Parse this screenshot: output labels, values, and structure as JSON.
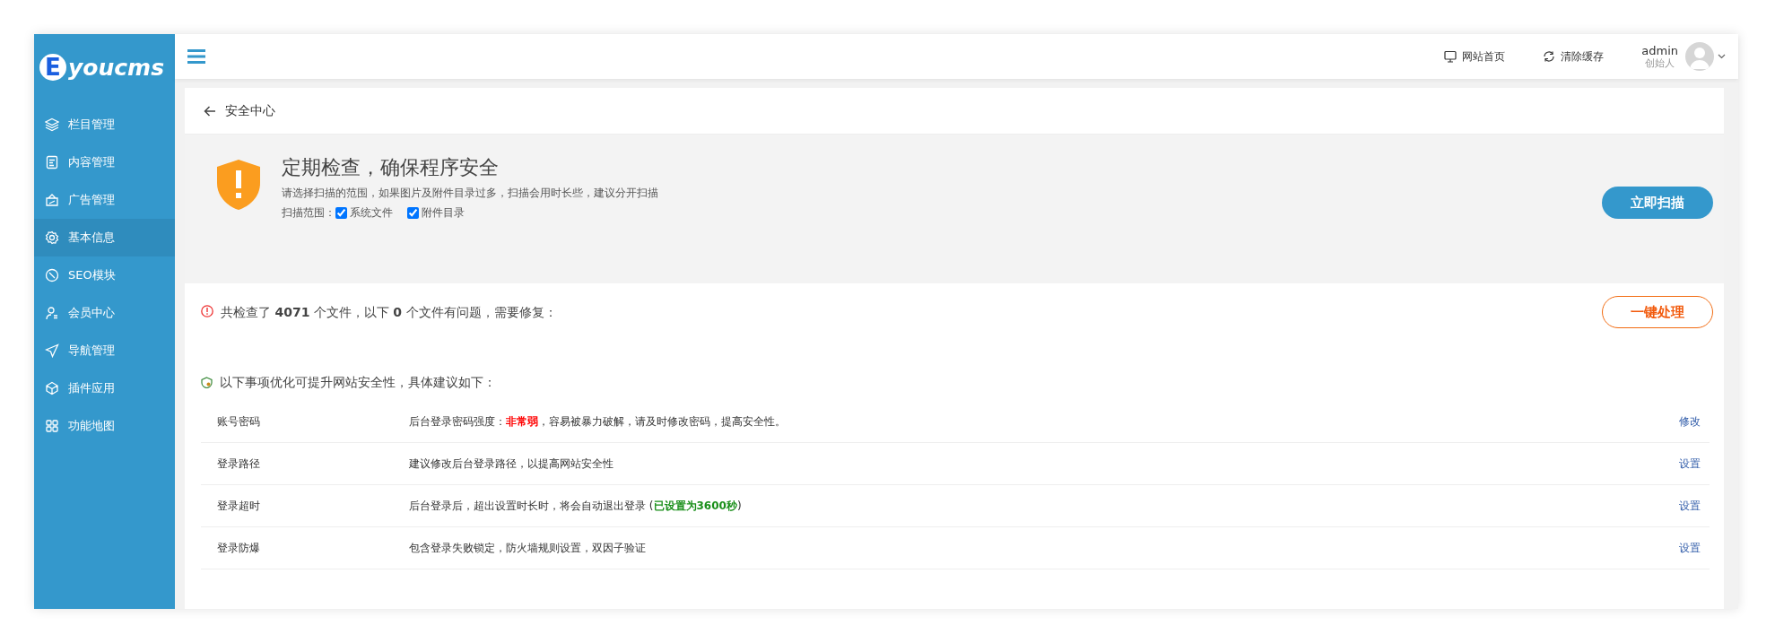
{
  "logo": {
    "mark": "E",
    "text": "youcms"
  },
  "sidebar": {
    "items": [
      {
        "label": "栏目管理",
        "selected": false
      },
      {
        "label": "内容管理",
        "selected": false
      },
      {
        "label": "广告管理",
        "selected": false
      },
      {
        "label": "基本信息",
        "selected": true
      },
      {
        "label": "SEO模块",
        "selected": false
      },
      {
        "label": "会员中心",
        "selected": false
      },
      {
        "label": "导航管理",
        "selected": false
      },
      {
        "label": "插件应用",
        "selected": false
      },
      {
        "label": "功能地图",
        "selected": false
      }
    ]
  },
  "header": {
    "links": [
      "网站首页",
      "清除缓存"
    ],
    "user": {
      "name": "admin",
      "role": "创始人"
    }
  },
  "page_title": "安全中心",
  "scan_panel": {
    "title": "定期检查，确保程序安全",
    "hint": "请选择扫描的范围，如果图片及附件目录过多，扫描会用时长些，建议分开扫描",
    "scope_label": "扫描范围：",
    "options": [
      {
        "label": "系统文件",
        "checked": true
      },
      {
        "label": "附件目录",
        "checked": true
      }
    ],
    "button": "立即扫描"
  },
  "result": {
    "summary": "共检查了 **4071** 个文件，以下 **0** 个文件有问题，需要修复：",
    "button": "一键处理"
  },
  "suggestions": {
    "heading": "以下事项优化可提升网站安全性，具体建议如下：",
    "rows": [
      {
        "name": "账号密码",
        "description": [
          "后台登录密码强度：",
          {
            "text": "非常弱",
            "color": "#ff0000"
          },
          "，容易被暴力破解，请及时修改密码，提高安全性。"
        ],
        "action": "修改"
      },
      {
        "name": "登录路径",
        "description": [
          "建议修改后台登录路径，以提高网站安全性"
        ],
        "action": "设置"
      },
      {
        "name": "登录超时",
        "description": [
          "后台登录后，超出设置时长时，将会自动退出登录 (",
          {
            "text": "已设置为3600秒",
            "color": "#1a8f1a"
          },
          ")"
        ],
        "action": "设置"
      },
      {
        "name": "登录防爆",
        "description": [
          "包含登录失败锁定，防火墙规则设置，双因子验证"
        ],
        "action": "设置"
      }
    ]
  }
}
